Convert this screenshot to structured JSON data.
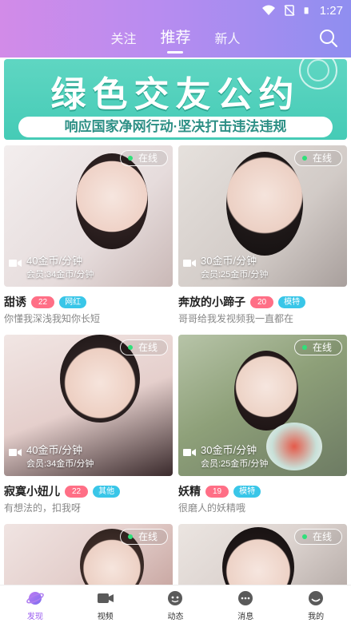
{
  "status_bar": {
    "time": "1:27"
  },
  "header": {
    "tabs": [
      {
        "label": "关注",
        "active": false
      },
      {
        "label": "推荐",
        "active": true
      },
      {
        "label": "新人",
        "active": false
      }
    ],
    "search_icon": "search-icon",
    "colors": {
      "gradient_start": "#d28be8",
      "gradient_end": "#8f8ef0"
    }
  },
  "banner": {
    "title": "绿色交友公约",
    "subtitle": "响应国家净网行动·坚决打击违法违规",
    "color": "#45cbb6"
  },
  "cards": [
    {
      "name": "甜诱",
      "age": "22",
      "tag": "网红",
      "status": "在线",
      "price": "40金币/分钟",
      "member_price": "会员:34金币/分钟",
      "signature": "你懂我深浅我知你长短",
      "bg": "#efe9ea"
    },
    {
      "name": "奔放的小蹄子",
      "age": "20",
      "tag": "模特",
      "status": "在线",
      "price": "30金币/分钟",
      "member_price": "会员:25金币/分钟",
      "signature": "哥哥给我发视频我一直都在",
      "bg": "#dcd6d3"
    },
    {
      "name": "寂寞小妞儿",
      "age": "22",
      "tag": "其他",
      "status": "在线",
      "price": "40金币/分钟",
      "member_price": "会员:34金币/分钟",
      "signature": "有想法的，扣我呀",
      "bg": "#e9d9d9"
    },
    {
      "name": "妖精",
      "age": "19",
      "tag": "模特",
      "status": "在线",
      "price": "30金币/分钟",
      "member_price": "会员:25金币/分钟",
      "signature": "很磨人的妖精哦",
      "bg": "#9bb08b"
    },
    {
      "name": "",
      "age": "",
      "tag": "",
      "status": "在线",
      "price": "",
      "member_price": "",
      "signature": "",
      "bg": "#e8d8d6"
    },
    {
      "name": "",
      "age": "",
      "tag": "",
      "status": "在线",
      "price": "",
      "member_price": "",
      "signature": "",
      "bg": "#e6e0dc"
    }
  ],
  "bottom_nav": [
    {
      "label": "发现",
      "icon": "planet-icon",
      "active": true
    },
    {
      "label": "视频",
      "icon": "video-camera-icon",
      "active": false
    },
    {
      "label": "动态",
      "icon": "chat-bubbles-icon",
      "active": false
    },
    {
      "label": "消息",
      "icon": "message-icon",
      "active": false
    },
    {
      "label": "我的",
      "icon": "profile-icon",
      "active": false
    }
  ]
}
